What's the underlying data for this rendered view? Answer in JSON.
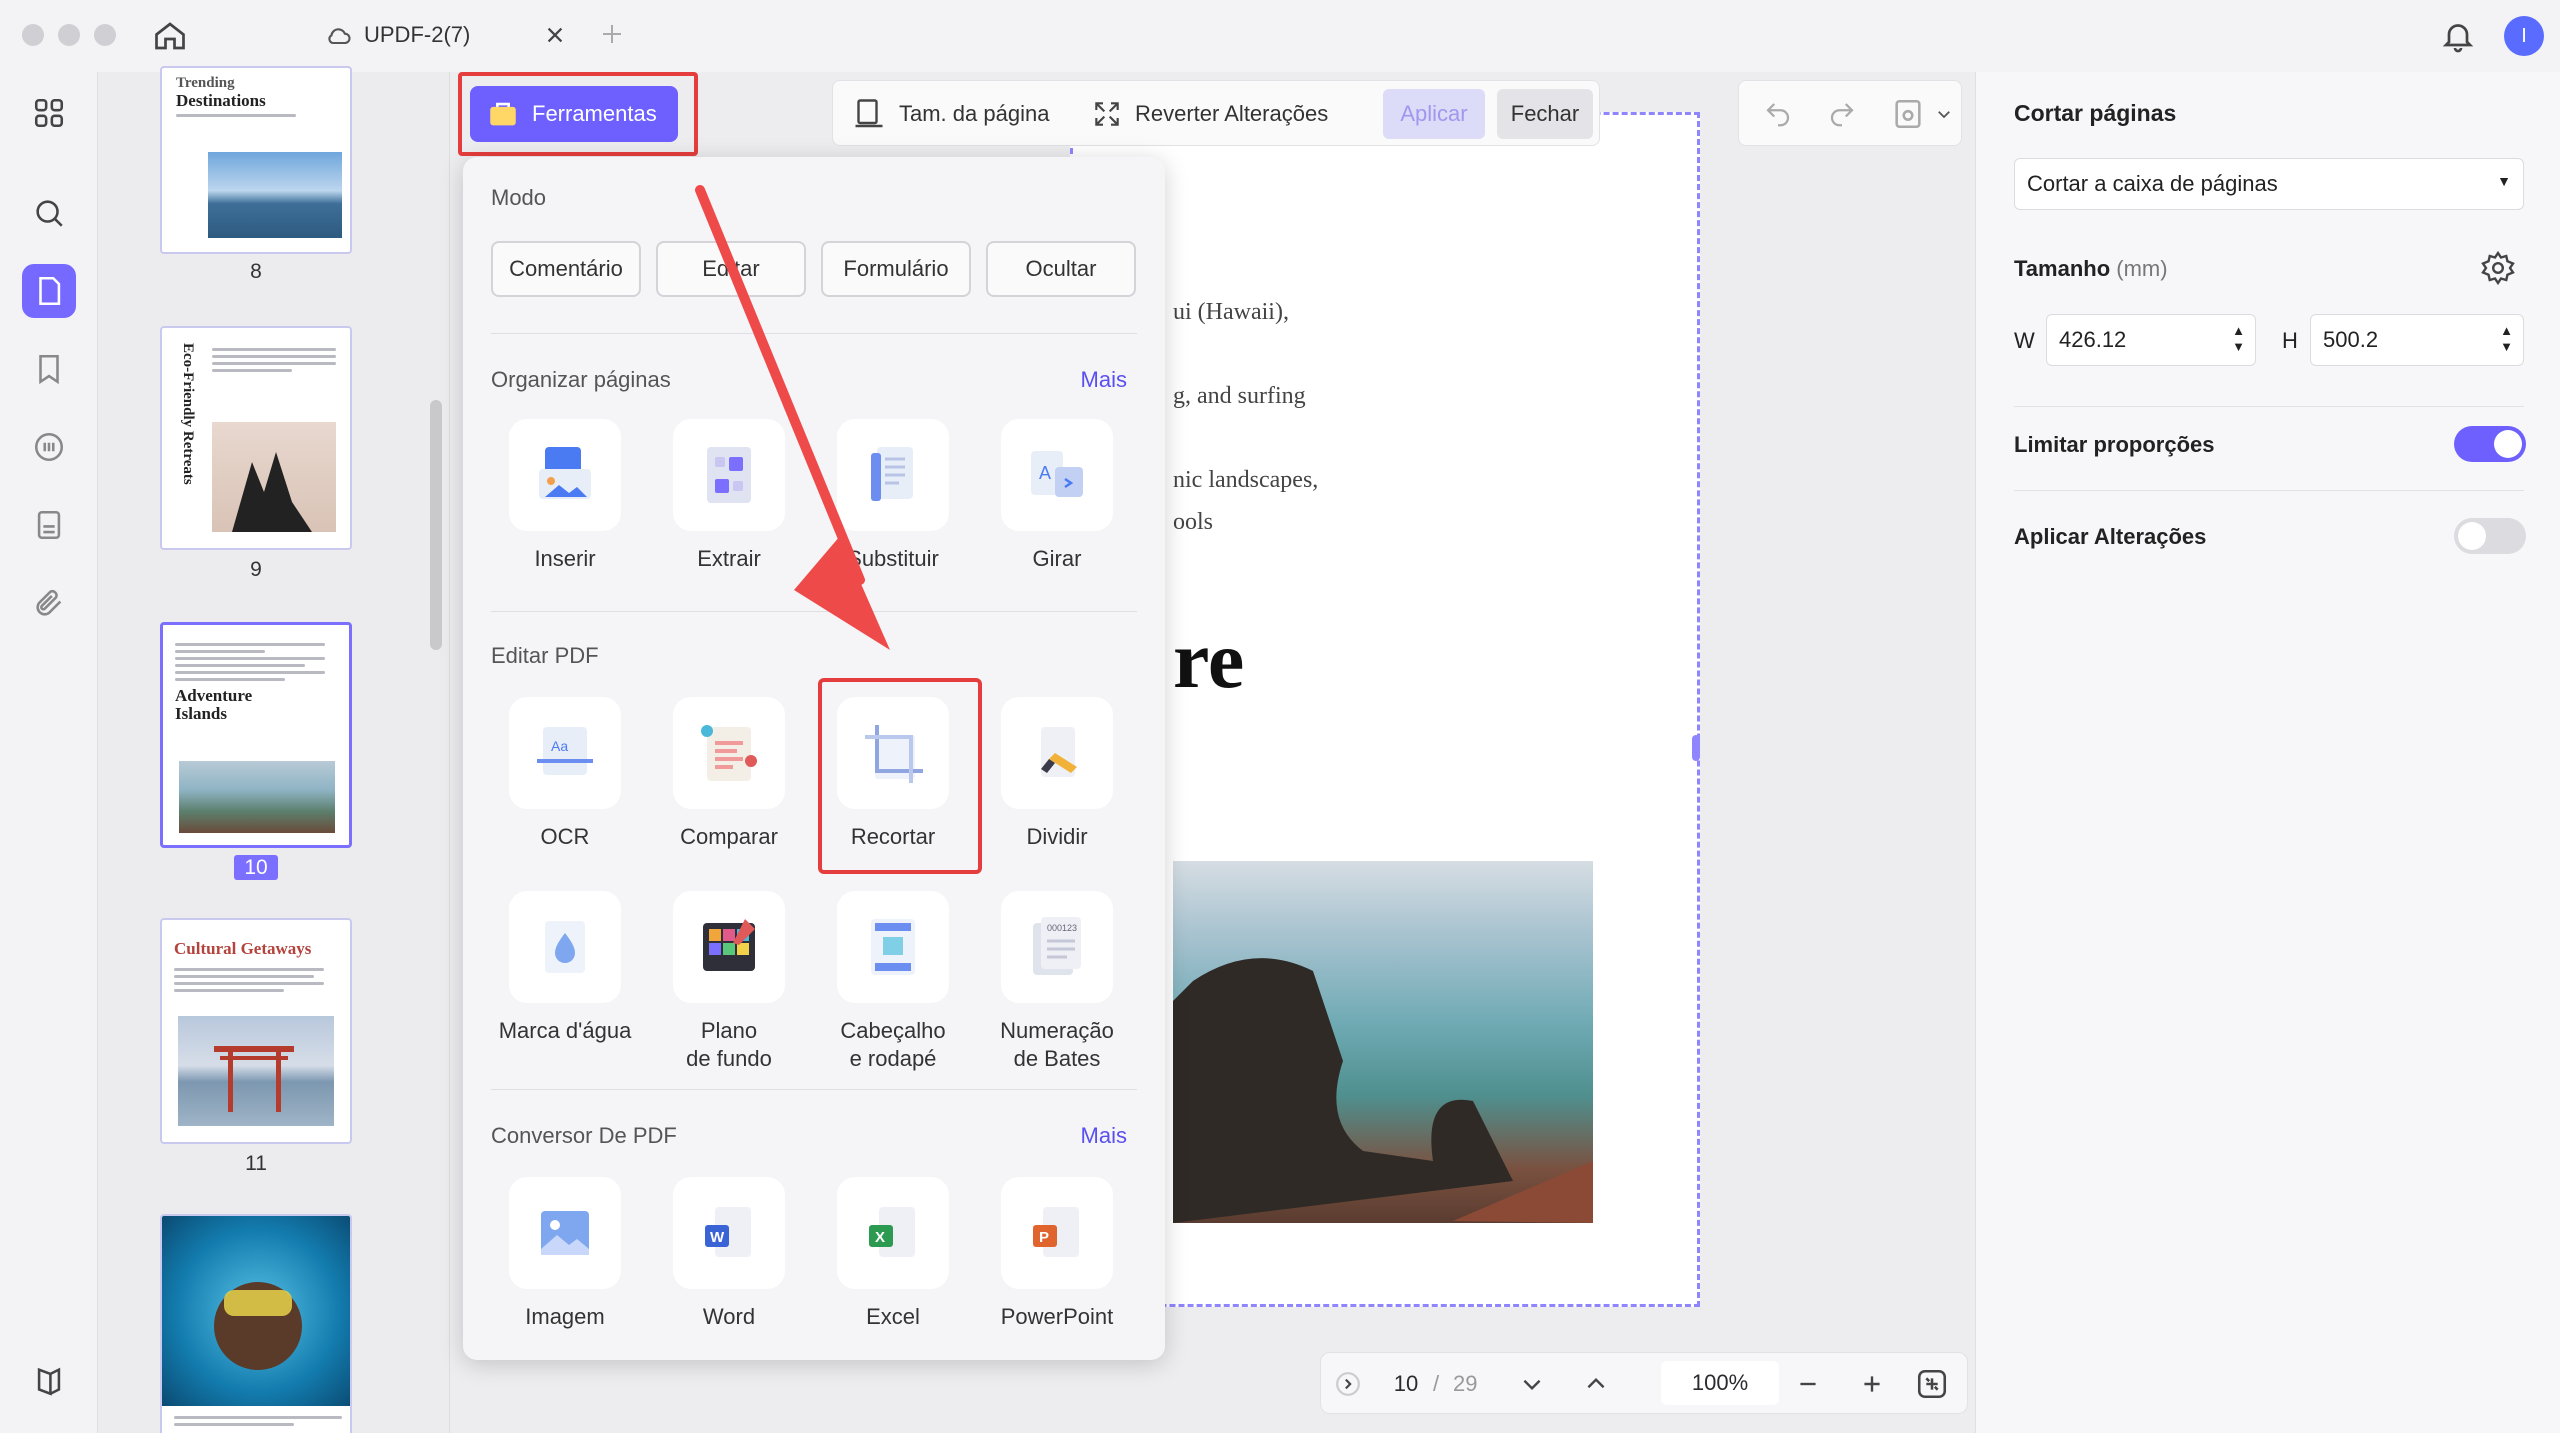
{
  "window": {
    "tab_title": "UPDF-2(7)",
    "avatar_letter": "I"
  },
  "toolbar": {
    "tools_label": "Ferramentas",
    "page_size_label": "Tam. da página",
    "revert_label": "Reverter Alterações",
    "apply_label": "Aplicar",
    "close_label": "Fechar"
  },
  "thumbnails": [
    {
      "page": "8",
      "title_line1": "Trending",
      "title_line2": "Destinations"
    },
    {
      "page": "9",
      "title_line1": "Eco-Friendly Retreats"
    },
    {
      "page": "10",
      "title_line1": "Adventure",
      "title_line2": "Islands"
    },
    {
      "page": "11",
      "title_line1": "Cultural Getaways"
    }
  ],
  "page_preview": {
    "line1": "ui (Hawaii),",
    "line2": "g, and surfing",
    "line3": "nic landscapes,",
    "line4": "ools",
    "heading": "re"
  },
  "popup": {
    "mode": {
      "header": "Modo",
      "buttons": [
        "Comentário",
        "Editar",
        "Formulário",
        "Ocultar"
      ]
    },
    "organize": {
      "header": "Organizar páginas",
      "more": "Mais",
      "tools": [
        "Inserir",
        "Extrair",
        "Substituir",
        "Girar"
      ]
    },
    "edit": {
      "header": "Editar PDF",
      "tools": [
        "OCR",
        "Comparar",
        "Recortar",
        "Dividir"
      ],
      "tools2": [
        {
          "l1": "Marca d'água",
          "l2": ""
        },
        {
          "l1": "Plano",
          "l2": "de fundo"
        },
        {
          "l1": "Cabeçalho",
          "l2": "e rodapé"
        },
        {
          "l1": "Numeração",
          "l2": "de Bates"
        }
      ]
    },
    "converter": {
      "header": "Conversor De PDF",
      "more": "Mais",
      "tools": [
        "Imagem",
        "Word",
        "Excel",
        "PowerPoint"
      ]
    }
  },
  "bottom_nav": {
    "current_page": "10",
    "separator": "/",
    "total_pages": "29",
    "zoom": "100%"
  },
  "right_panel": {
    "title": "Cortar páginas",
    "crop_box_select": "Cortar a caixa de páginas",
    "size_label": "Tamanho",
    "size_unit": "(mm)",
    "w_label": "W",
    "w_value": "426.12",
    "h_label": "H",
    "h_value": "500.2",
    "lock_ratio_label": "Limitar proporções",
    "lock_ratio_on": true,
    "apply_changes_label": "Aplicar Alterações",
    "apply_changes_on": false
  },
  "colors": {
    "accent": "#6d60ff",
    "highlight": "#e53d3d"
  }
}
